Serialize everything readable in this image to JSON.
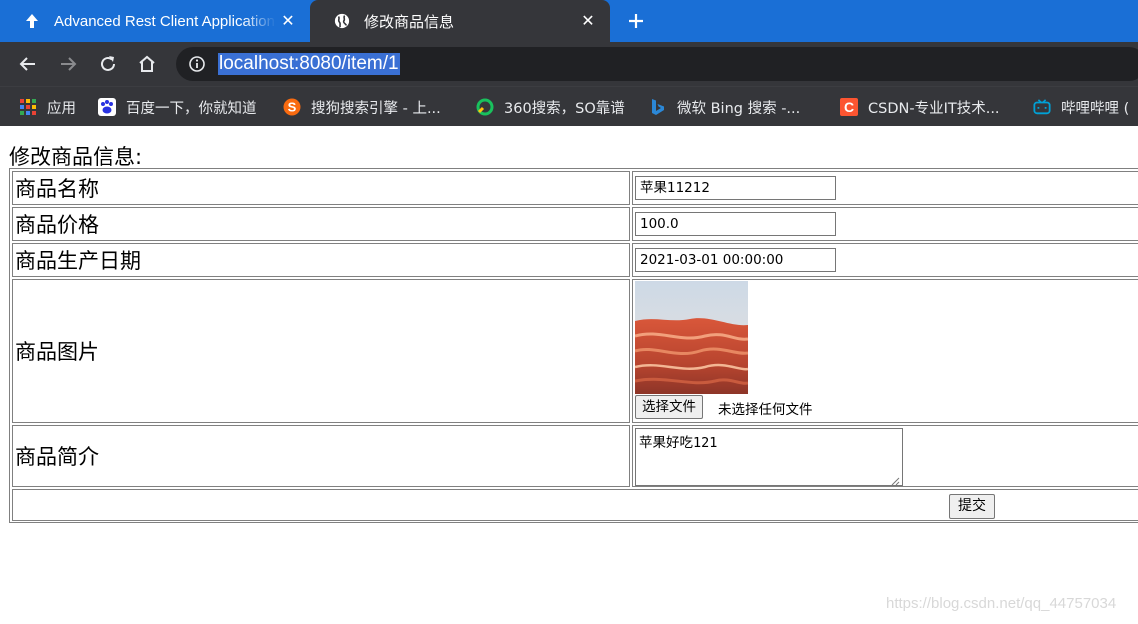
{
  "browser": {
    "tabs": [
      {
        "title": "Advanced Rest Client Application",
        "favicon": "arrow-up-icon",
        "active": false
      },
      {
        "title": "修改商品信息",
        "favicon": "globe-icon",
        "active": true
      }
    ],
    "url": "localhost:8080/item/1",
    "bookmarks": [
      {
        "label": "应用",
        "icon": "apps-grid-icon"
      },
      {
        "label": "百度一下，你就知道",
        "icon": "baidu-paw-icon"
      },
      {
        "label": "搜狗搜索引擎 - 上...",
        "icon": "sogou-icon"
      },
      {
        "label": "360搜索，SO靠谱",
        "icon": "360-icon"
      },
      {
        "label": "微软 Bing 搜索 -...",
        "icon": "bing-icon"
      },
      {
        "label": "CSDN-专业IT技术...",
        "icon": "csdn-icon"
      },
      {
        "label": "哔哩哔哩 (",
        "icon": "bilibili-icon"
      }
    ],
    "colors": {
      "tabstrip": "#1a6fd6",
      "toolbar": "#35363a",
      "omnibox": "#202124",
      "url_highlight": "#3a70d4"
    }
  },
  "page": {
    "heading": "修改商品信息:",
    "rows": [
      {
        "label": "商品名称",
        "value": "苹果11212"
      },
      {
        "label": "商品价格",
        "value": "100.0"
      },
      {
        "label": "商品生产日期",
        "value": "2021-03-01 00:00:00"
      },
      {
        "label": "商品图片",
        "file_button": "选择文件",
        "file_status": "未选择任何文件"
      },
      {
        "label": "商品简介",
        "value": "苹果好吃121"
      }
    ],
    "submit_label": "提交",
    "watermark": "https://blog.csdn.net/qq_44757034"
  }
}
